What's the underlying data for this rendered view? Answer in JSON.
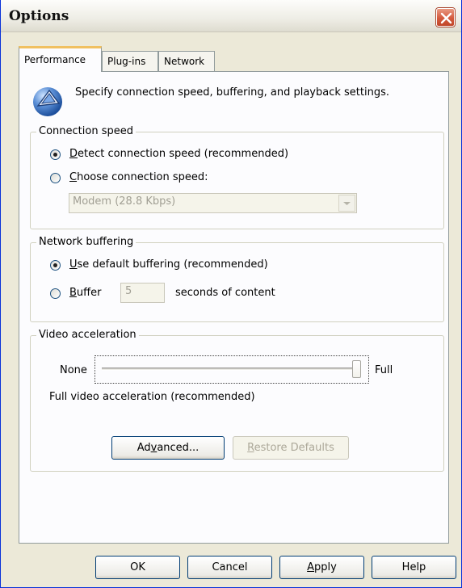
{
  "window": {
    "title": "Options"
  },
  "tabs": [
    {
      "label": "Performance",
      "active": true
    },
    {
      "label": "Plug-ins",
      "active": false
    },
    {
      "label": "Network",
      "active": false
    }
  ],
  "description": "Specify connection speed, buffering, and playback settings.",
  "connection_speed": {
    "legend": "Connection speed",
    "detect_label_key": "D",
    "detect_label_rest": "etect connection speed (recommended)",
    "choose_label_key": "C",
    "choose_label_rest": "hoose connection speed:",
    "selected": "detect",
    "speed_select_value": "Modem (28.8 Kbps)"
  },
  "network_buffering": {
    "legend": "Network buffering",
    "default_label_key": "U",
    "default_label_rest": "se default buffering (recommended)",
    "buffer_label_key": "B",
    "buffer_label_rest": "uffer",
    "buffer_value": "5",
    "buffer_suffix": "seconds of content",
    "selected": "default"
  },
  "video_acceleration": {
    "legend": "Video acceleration",
    "min_label": "None",
    "max_label": "Full",
    "level": 1.0,
    "status": "Full video acceleration (recommended)",
    "advanced_pre": "Ad",
    "advanced_key": "v",
    "advanced_post": "anced...",
    "restore_key": "R",
    "restore_rest": "estore Defaults"
  },
  "footer": {
    "ok": "OK",
    "cancel": "Cancel",
    "apply_key": "A",
    "apply_rest": "pply",
    "help": "Help"
  },
  "colors": {
    "title_close": "#d45a3d",
    "tab_highlight": "#f0c060",
    "panel": "#fcfcfe",
    "chrome": "#ece9d8"
  }
}
